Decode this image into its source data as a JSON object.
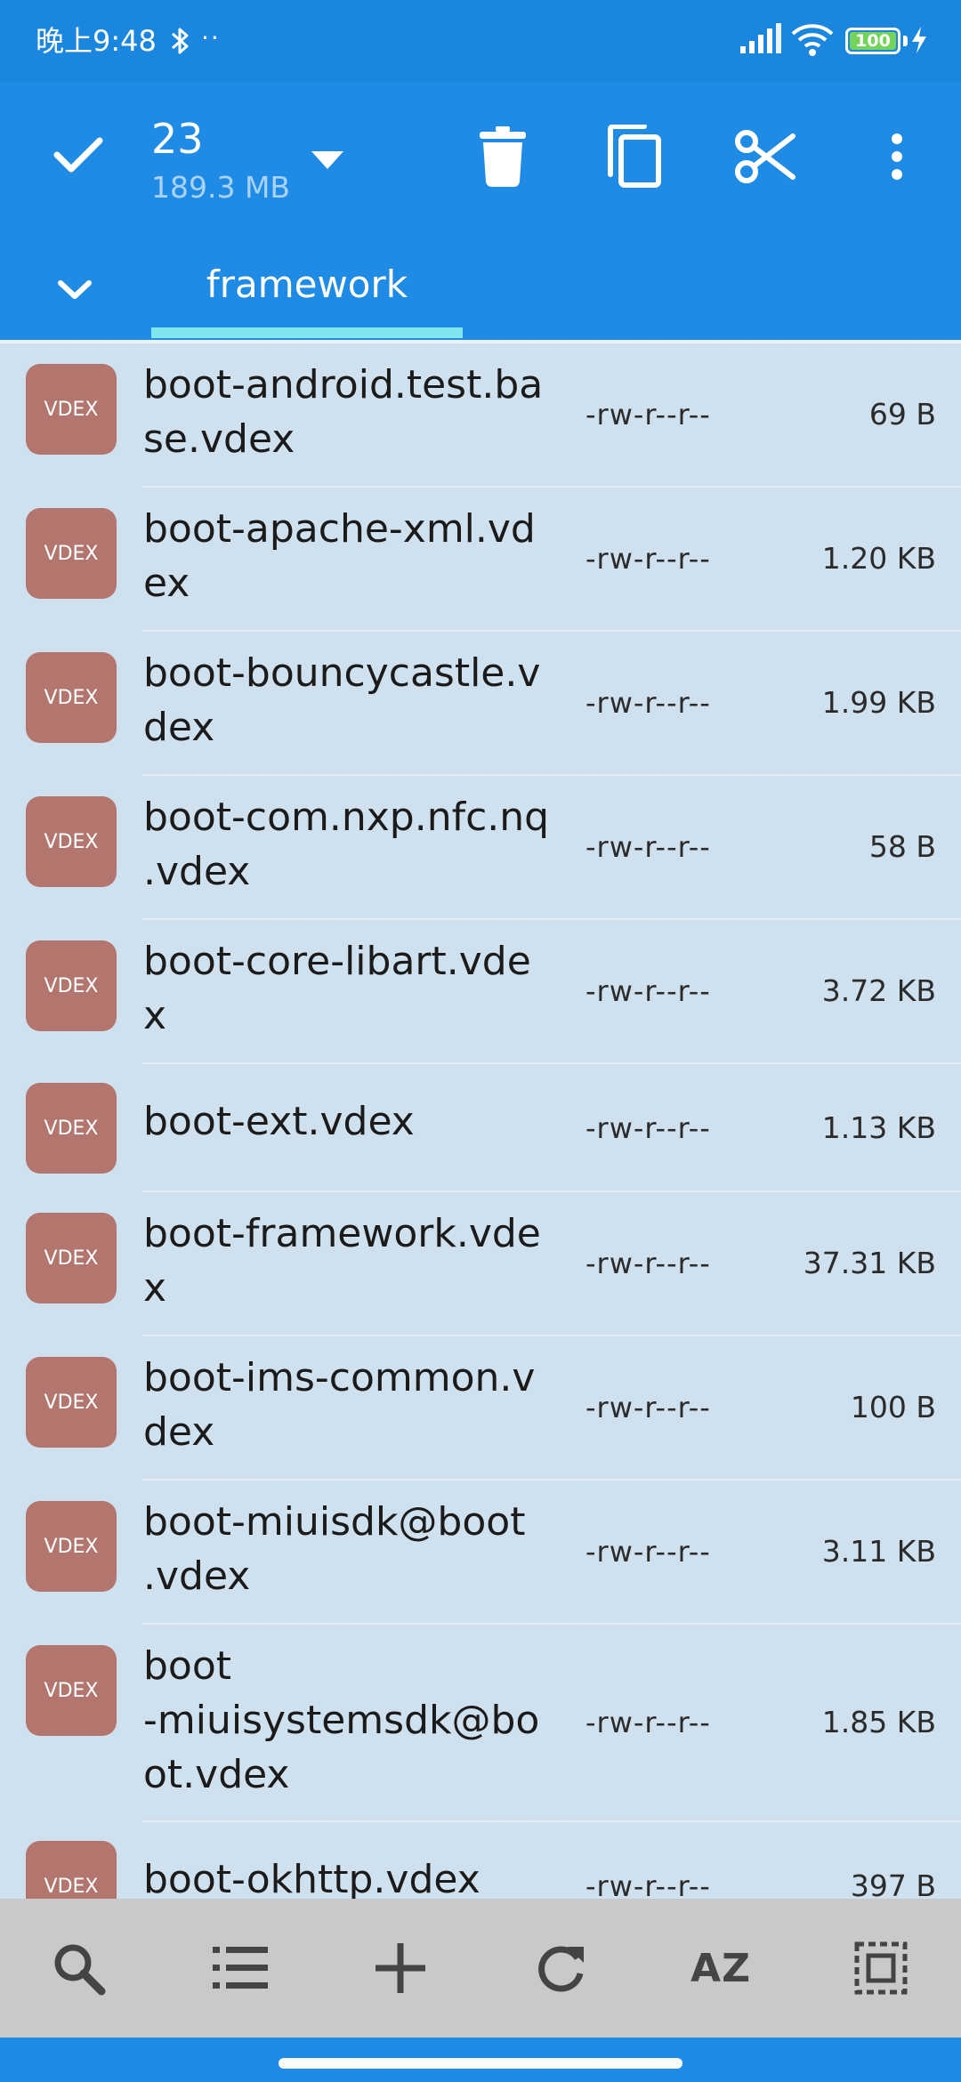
{
  "status": {
    "time": "晚上9:48",
    "dots": "··",
    "battery": "100"
  },
  "toolbar": {
    "count": "23",
    "size": "189.3 MB"
  },
  "tab": {
    "label": "framework"
  },
  "files": [
    {
      "name": "boot-android.test.ba\nse.vdex",
      "perm": "-rw-r--r--",
      "size": "69 B",
      "type": "VDEX"
    },
    {
      "name": "boot-apache-xml.vd\nex",
      "perm": "-rw-r--r--",
      "size": "1.20 KB",
      "type": "VDEX"
    },
    {
      "name": "boot-bouncycastle.v\ndex",
      "perm": "-rw-r--r--",
      "size": "1.99 KB",
      "type": "VDEX"
    },
    {
      "name": "boot-com.nxp.nfc.nq\n.vdex",
      "perm": "-rw-r--r--",
      "size": "58 B",
      "type": "VDEX"
    },
    {
      "name": "boot-core-libart.vde\nx",
      "perm": "-rw-r--r--",
      "size": "3.72 KB",
      "type": "VDEX"
    },
    {
      "name": "boot-ext.vdex",
      "perm": "-rw-r--r--",
      "size": "1.13 KB",
      "type": "VDEX"
    },
    {
      "name": "boot-framework.vde\nx",
      "perm": "-rw-r--r--",
      "size": "37.31 KB",
      "type": "VDEX"
    },
    {
      "name": "boot-ims-common.v\ndex",
      "perm": "-rw-r--r--",
      "size": "100 B",
      "type": "VDEX"
    },
    {
      "name": "boot-miuisdk@boot\n.vdex",
      "perm": "-rw-r--r--",
      "size": "3.11 KB",
      "type": "VDEX"
    },
    {
      "name": "boot\n-miuisystemsdk@bo\not.vdex",
      "perm": "-rw-r--r--",
      "size": "1.85 KB",
      "type": "VDEX"
    },
    {
      "name": "boot-okhttp.vdex",
      "perm": "-rw-r--r--",
      "size": "397 B",
      "type": "VDEX"
    }
  ],
  "bottom": {
    "sort_label": "AZ"
  }
}
